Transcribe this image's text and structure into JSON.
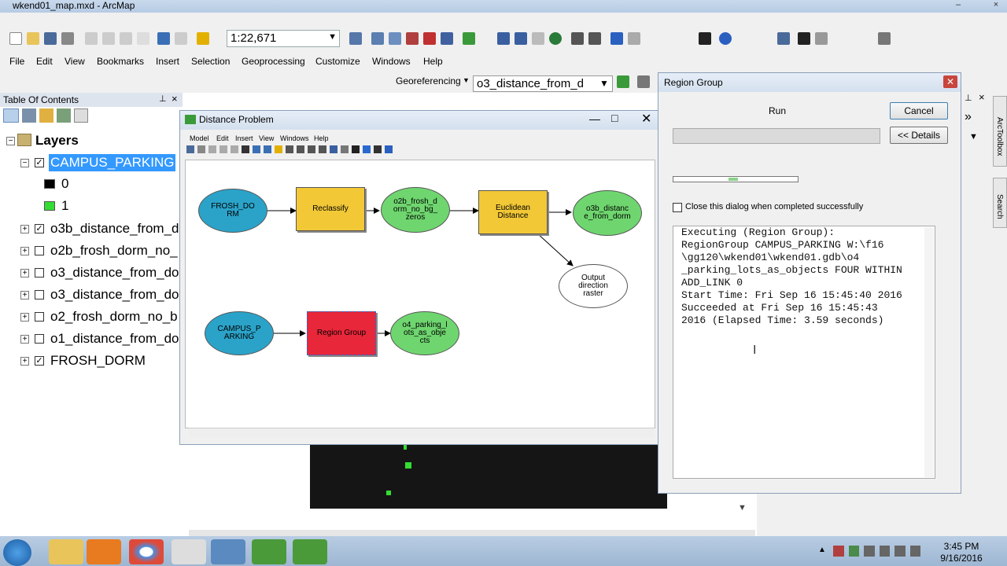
{
  "app": {
    "window_title": "wkend01_map.mxd - ArcMap"
  },
  "toolbar": {
    "scale_value": "1:22,671"
  },
  "menu": [
    "File",
    "Edit",
    "View",
    "Bookmarks",
    "Insert",
    "Selection",
    "Geoprocessing",
    "Customize",
    "Windows",
    "Help"
  ],
  "georef": {
    "label": "Georeferencing",
    "layer_value": "o3_distance_from_d"
  },
  "toc": {
    "title": "Table Of Contents",
    "root": "Layers",
    "layers": [
      {
        "name": "CAMPUS_PARKING",
        "selected": true,
        "checked": true,
        "expanded": true
      },
      {
        "legend": "0",
        "color": "#000000"
      },
      {
        "legend": "1",
        "color": "#33dd33"
      },
      {
        "name": "o3b_distance_from_d",
        "checked": true
      },
      {
        "name": "o2b_frosh_dorm_no_",
        "checked": false
      },
      {
        "name": "o3_distance_from_do",
        "checked": false
      },
      {
        "name": "o3_distance_from_do",
        "checked": false
      },
      {
        "name": "o2_frosh_dorm_no_b",
        "checked": false
      },
      {
        "name": "o1_distance_from_do",
        "checked": false
      },
      {
        "name": "FROSH_DORM",
        "checked": true
      }
    ]
  },
  "model": {
    "title": "Distance Problem",
    "menu": [
      "Model",
      "Edit",
      "Insert",
      "View",
      "Windows",
      "Help"
    ],
    "nodes": {
      "frosh_dorm": "FROSH_DO\nRM",
      "reclassify": "Reclassify",
      "o2b": "o2b_frosh_d\norm_no_bg_\nzeros",
      "euclid": "Euclidean\nDistance",
      "o3b": "o3b_distanc\ne_from_dorm",
      "output_dir": "Output\ndirection\nraster",
      "campus": "CAMPUS_P\nARKING",
      "region": "Region Group",
      "o4": "o4_parking_l\nots_as_obje\ncts"
    }
  },
  "dialog": {
    "title": "Region Group",
    "status": "Run",
    "cancel": "Cancel",
    "details": "<< Details",
    "close_when_done": "Close this dialog when completed successfully",
    "log": "Executing (Region Group):\nRegionGroup CAMPUS_PARKING W:\\f16\n\\gg120\\wkend01\\wkend01.gdb\\o4\n_parking_lots_as_objects FOUR WITHIN\nADD_LINK 0\nStart Time: Fri Sep 16 15:45:40 2016\nSucceeded at Fri Sep 16 15:45:43\n2016 (Elapsed Time: 3.59 seconds)"
  },
  "side_tabs": [
    "ArcToolbox",
    "Search"
  ],
  "clock": {
    "time": "3:45 PM",
    "date": "9/16/2016"
  }
}
